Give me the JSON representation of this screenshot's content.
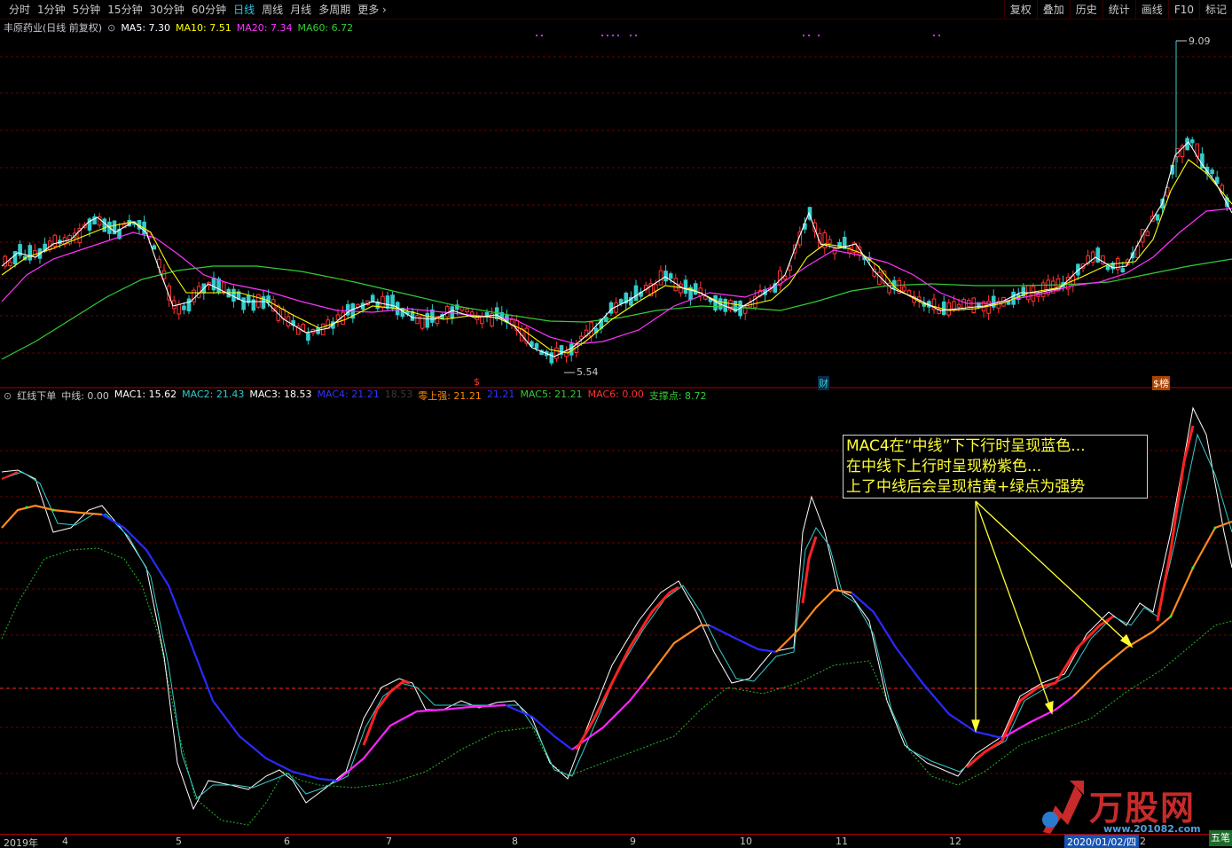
{
  "toolbar": {
    "tabs": [
      "分时",
      "1分钟",
      "5分钟",
      "15分钟",
      "30分钟",
      "60分钟",
      "日线",
      "周线",
      "月线",
      "多周期",
      "更多"
    ],
    "active_tab": "日线",
    "tools": [
      "复权",
      "叠加",
      "历史",
      "统计",
      "画线",
      "F10",
      "标记"
    ]
  },
  "main_panel": {
    "stock": "丰原药业(日线 前复权)",
    "indicators": [
      {
        "label": "MA5: 7.30",
        "color": "#ffffff"
      },
      {
        "label": "MA10: 7.51",
        "color": "#ffff00"
      },
      {
        "label": "MA20: 7.34",
        "color": "#ff33ff"
      },
      {
        "label": "MA60: 6.72",
        "color": "#33cc33"
      }
    ],
    "high_label": "9.09",
    "low_label": "5.54",
    "event_markers": [
      "$",
      "财",
      "$榜"
    ]
  },
  "sub_panel": {
    "indicator_name": "红线下单",
    "values": [
      {
        "label": "中线: 0.00",
        "color": "#c8c8c8"
      },
      {
        "label": "MAC1: 15.62",
        "color": "#ffffff"
      },
      {
        "label": "MAC2: 21.43",
        "color": "#33cccc"
      },
      {
        "label": "MAC3: 18.53",
        "color": "#ffffff"
      },
      {
        "label": "MAC4: 21.21",
        "color": "#3333ff"
      },
      {
        "label": "18.53",
        "color": "#3a3a3a"
      },
      {
        "label": "零上强: 21.21",
        "color": "#ff8800"
      },
      {
        "label": "21.21",
        "color": "#3333ff"
      },
      {
        "label": "MAC5: 21.21",
        "color": "#33cc33"
      },
      {
        "label": "MAC6: 0.00",
        "color": "#ff3333"
      },
      {
        "label": "支撑点: 8.72",
        "color": "#33cc33"
      }
    ],
    "annotation": [
      "MAC4在“中线”下下行时呈现蓝色...",
      "在中线下上行时呈现粉紫色...",
      "上了中线后会呈现桔黄+绿点为强势"
    ]
  },
  "x_axis": {
    "labels": [
      "2019年",
      "4",
      "5",
      "6",
      "7",
      "8",
      "9",
      "10",
      "11",
      "12",
      "2"
    ],
    "current_date": "2020/01/02/四",
    "period_badge": "五笔"
  },
  "watermark": {
    "text": "万股网",
    "url": "www.201082.com"
  },
  "colors": {
    "up": "#ff3333",
    "down": "#33cccc",
    "ma5": "#ffffff",
    "ma10": "#ffff00",
    "ma20": "#ff33ff",
    "ma60": "#33cc33",
    "annotation": "#ffff33"
  }
}
